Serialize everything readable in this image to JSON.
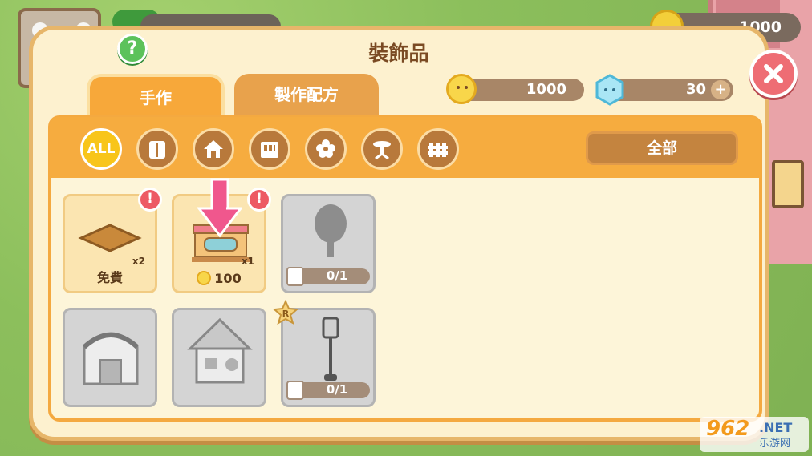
{
  "header": {
    "title": "裝飾品",
    "top_coins": "1000"
  },
  "currency": {
    "coins": "1000",
    "gems": "30"
  },
  "tabs": [
    {
      "label": "手作",
      "active": true
    },
    {
      "label": "製作配方",
      "active": false
    }
  ],
  "categories": [
    {
      "label": "ALL",
      "icon": "all-icon",
      "active": true
    },
    {
      "label": "",
      "icon": "wardrobe-icon"
    },
    {
      "label": "",
      "icon": "house-icon"
    },
    {
      "label": "",
      "icon": "shop-front-icon"
    },
    {
      "label": "",
      "icon": "flower-icon"
    },
    {
      "label": "",
      "icon": "table-icon"
    },
    {
      "label": "",
      "icon": "fence-icon"
    }
  ],
  "filter": {
    "label": "全部"
  },
  "items": [
    {
      "name": "免費",
      "qty": "x2",
      "alert": true,
      "state": "available"
    },
    {
      "price": "100",
      "qty": "x1",
      "alert": true,
      "state": "available"
    },
    {
      "progress": "0/1",
      "state": "locked",
      "icon": "tree-icon"
    },
    {
      "state": "locked",
      "icon": "barn-icon"
    },
    {
      "state": "locked",
      "icon": "cottage-icon"
    },
    {
      "progress": "0/1",
      "state": "locked",
      "icon": "street-lamp-icon",
      "rare": "R"
    }
  ],
  "watermark": {
    "brand": "962",
    "domain": ".NET",
    "site": "乐游网"
  },
  "colors": {
    "accent_orange": "#f6ac3f",
    "dialog_bg": "#fdf1cf",
    "close_red": "#ee6d74",
    "help_green": "#5cc25b"
  }
}
